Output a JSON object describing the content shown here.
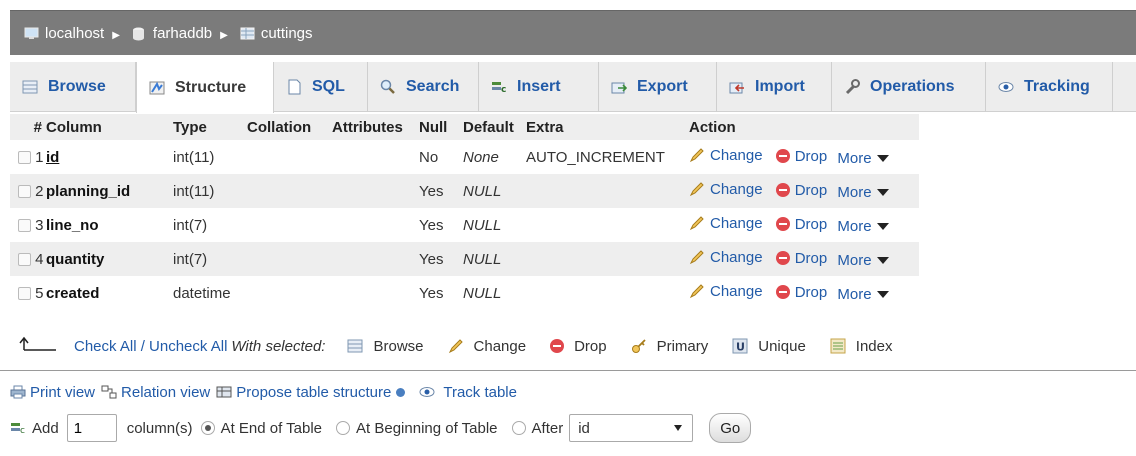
{
  "breadcrumb": {
    "server": "localhost",
    "database": "farhaddb",
    "table": "cuttings"
  },
  "tabs": [
    {
      "label": "Browse",
      "icon": "browse-icon",
      "active": false
    },
    {
      "label": "Structure",
      "icon": "structure-icon",
      "active": true
    },
    {
      "label": "SQL",
      "icon": "sql-icon",
      "active": false
    },
    {
      "label": "Search",
      "icon": "search-icon",
      "active": false
    },
    {
      "label": "Insert",
      "icon": "insert-icon",
      "active": false
    },
    {
      "label": "Export",
      "icon": "export-icon",
      "active": false
    },
    {
      "label": "Import",
      "icon": "import-icon",
      "active": false
    },
    {
      "label": "Operations",
      "icon": "wrench-icon",
      "active": false
    },
    {
      "label": "Tracking",
      "icon": "eye-icon",
      "active": false
    }
  ],
  "table": {
    "headers": {
      "num": "#",
      "column": "Column",
      "type": "Type",
      "collation": "Collation",
      "attributes": "Attributes",
      "null": "Null",
      "default": "Default",
      "extra": "Extra",
      "action": "Action"
    },
    "rows": [
      {
        "num": "1",
        "name": "id",
        "type": "int(11)",
        "collation": "",
        "attributes": "",
        "null": "No",
        "default": "None",
        "extra": "AUTO_INCREMENT"
      },
      {
        "num": "2",
        "name": "planning_id",
        "type": "int(11)",
        "collation": "",
        "attributes": "",
        "null": "Yes",
        "default": "NULL",
        "extra": ""
      },
      {
        "num": "3",
        "name": "line_no",
        "type": "int(7)",
        "collation": "",
        "attributes": "",
        "null": "Yes",
        "default": "NULL",
        "extra": ""
      },
      {
        "num": "4",
        "name": "quantity",
        "type": "int(7)",
        "collation": "",
        "attributes": "",
        "null": "Yes",
        "default": "NULL",
        "extra": ""
      },
      {
        "num": "5",
        "name": "created",
        "type": "datetime",
        "collation": "",
        "attributes": "",
        "null": "Yes",
        "default": "NULL",
        "extra": ""
      }
    ],
    "actions": {
      "change": "Change",
      "drop": "Drop",
      "more": "More"
    }
  },
  "with_selected": {
    "check_all": "Check All / Uncheck All",
    "label": "With selected:",
    "browse": "Browse",
    "change": "Change",
    "drop": "Drop",
    "primary": "Primary",
    "unique": "Unique",
    "index": "Index"
  },
  "links": {
    "print_view": "Print view",
    "relation_view": "Relation view",
    "propose": "Propose table structure",
    "track": "Track table"
  },
  "add_columns": {
    "add": "Add",
    "count": "1",
    "columns_label": "column(s)",
    "at_end": "At End of Table",
    "at_beginning": "At Beginning of Table",
    "after": "After",
    "after_selected": "id",
    "go": "Go"
  }
}
